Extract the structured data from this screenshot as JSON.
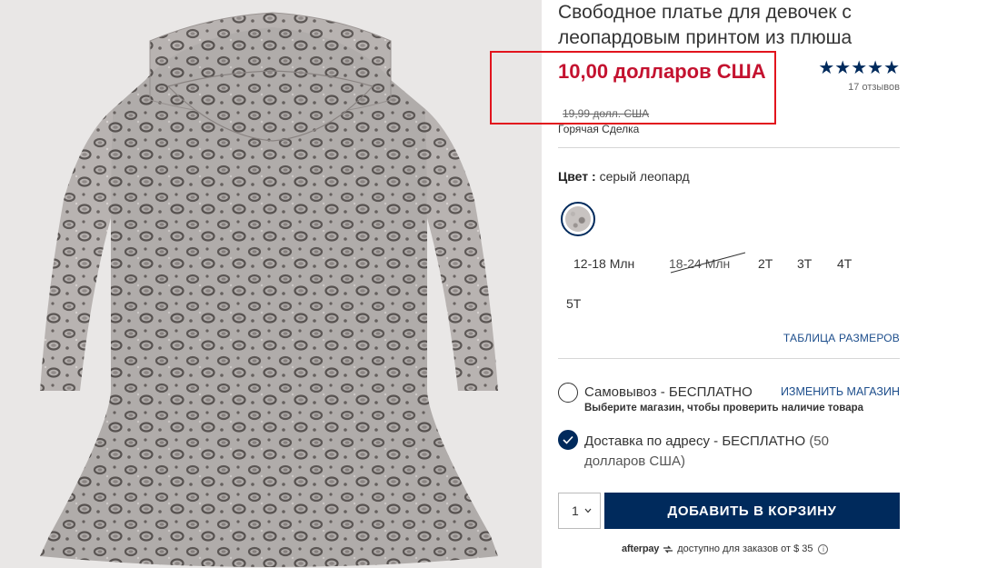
{
  "product": {
    "title": "Свободное платье для девочек с леопардовым принтом из плюша",
    "sale_price": "10,00 долларов США",
    "original_price": "19,99 долл. США",
    "deal_label": "Горячая Сделка",
    "rating_stars": "★★★★★",
    "rating_value": 5,
    "reviews": "17 отзывов"
  },
  "color": {
    "label": "Цвет :",
    "value": "серый леопард"
  },
  "sizes": [
    {
      "label": "12-18 Млн",
      "available": true
    },
    {
      "label": "18-24 Млн",
      "available": false
    },
    {
      "label": "2T",
      "available": true
    },
    {
      "label": "3T",
      "available": true
    },
    {
      "label": "4T",
      "available": true
    },
    {
      "label": "5T",
      "available": true
    }
  ],
  "size_chart_link": "ТАБЛИЦА РАЗМЕРОВ",
  "fulfillment": {
    "pickup_label": "Самовывоз - БЕСПЛАТНО",
    "change_store": "ИЗМЕНИТЬ МАГАЗИН",
    "pickup_sub": "Выберите магазин, чтобы проверить наличие товара",
    "ship_label": "Доставка по адресу - БЕСПЛАТНО",
    "ship_note": "(50 долларов США)",
    "selected": "ship"
  },
  "cart": {
    "quantity": "1",
    "add_button": "ДОБАВИТЬ В КОРЗИНУ"
  },
  "afterpay": {
    "brand": "afterpay",
    "text": "доступно для заказов от $ 35",
    "info": "i"
  },
  "colors": {
    "accent_navy": "#002a5c",
    "sale_red": "#c4122f",
    "highlight_border": "#e2141d",
    "link_blue": "#1d4e8c"
  }
}
